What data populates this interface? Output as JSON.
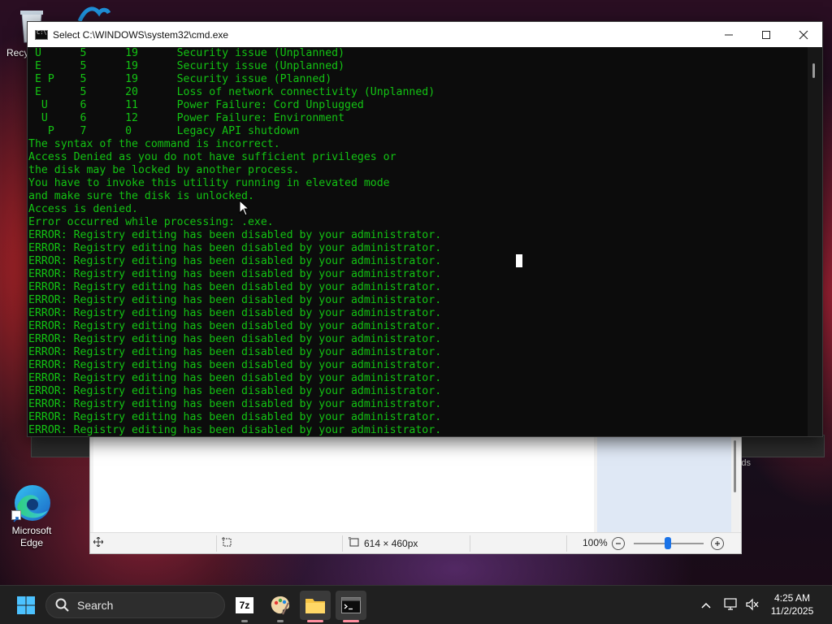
{
  "desktop": {
    "icons": [
      {
        "label": "Recy"
      },
      {
        "label": "Microsoft\nEdge"
      }
    ]
  },
  "cmd_window": {
    "title": "Select C:\\WINDOWS\\system32\\cmd.exe",
    "lines": [
      " U      5      19      Security issue (Unplanned)",
      " E      5      19      Security issue (Unplanned)",
      " E P    5      19      Security issue (Planned)",
      " E      5      20      Loss of network connectivity (Unplanned)",
      "  U     6      11      Power Failure: Cord Unplugged",
      "  U     6      12      Power Failure: Environment",
      "   P    7      0       Legacy API shutdown",
      "The syntax of the command is incorrect.",
      "Access Denied as you do not have sufficient privileges or",
      "the disk may be locked by another process.",
      "You have to invoke this utility running in elevated mode",
      "and make sure the disk is unlocked.",
      "Access is denied.",
      "Error occurred while processing: .exe.",
      "ERROR: Registry editing has been disabled by your administrator.",
      "ERROR: Registry editing has been disabled by your administrator.",
      "ERROR: Registry editing has been disabled by your administrator.",
      "ERROR: Registry editing has been disabled by your administrator.",
      "ERROR: Registry editing has been disabled by your administrator.",
      "ERROR: Registry editing has been disabled by your administrator.",
      "ERROR: Registry editing has been disabled by your administrator.",
      "ERROR: Registry editing has been disabled by your administrator.",
      "ERROR: Registry editing has been disabled by your administrator.",
      "ERROR: Registry editing has been disabled by your administrator.",
      "ERROR: Registry editing has been disabled by your administrator.",
      "ERROR: Registry editing has been disabled by your administrator.",
      "ERROR: Registry editing has been disabled by your administrator.",
      "ERROR: Registry editing has been disabled by your administrator.",
      "ERROR: Registry editing has been disabled by your administrator.",
      "ERROR: Registry editing has been disabled by your administrator."
    ],
    "text_color": "#13c313",
    "minimize_icon": "minimize-icon",
    "maximize_icon": "maximize-icon",
    "close_icon": "close-icon"
  },
  "behind_window": {
    "fragment_text": "ds"
  },
  "paint_window": {
    "image_size": "614 × 460px",
    "zoom": "100%"
  },
  "taskbar": {
    "search_label": "Search",
    "apps": [
      {
        "name": "start",
        "icon": "windows-logo-icon"
      },
      {
        "name": "7-Zip",
        "icon": "7zip-icon",
        "text": "7z"
      },
      {
        "name": "Paint",
        "icon": "paint-palette-icon"
      },
      {
        "name": "File Explorer",
        "icon": "folder-icon"
      },
      {
        "name": "Terminal",
        "icon": "terminal-icon"
      }
    ],
    "time": "4:25 AM",
    "date": "11/2/2025"
  }
}
